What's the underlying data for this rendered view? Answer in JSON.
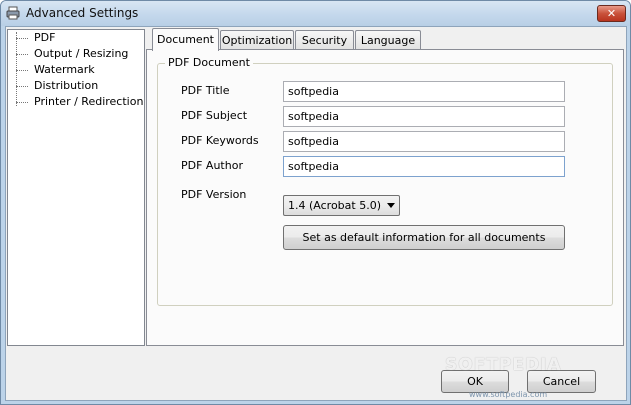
{
  "window": {
    "title": "Advanced Settings",
    "close_label": "✕"
  },
  "tree": {
    "items": [
      {
        "label": "PDF"
      },
      {
        "label": "Output / Resizing"
      },
      {
        "label": "Watermark"
      },
      {
        "label": "Distribution"
      },
      {
        "label": "Printer / Redirection"
      }
    ]
  },
  "tabs": [
    {
      "label": "Document",
      "active": true
    },
    {
      "label": "Optimization"
    },
    {
      "label": "Security"
    },
    {
      "label": "Language"
    }
  ],
  "document": {
    "group_title": "PDF Document",
    "fields": [
      {
        "label": "PDF Title",
        "value": "softpedia"
      },
      {
        "label": "PDF Subject",
        "value": "softpedia"
      },
      {
        "label": "PDF Keywords",
        "value": "softpedia"
      },
      {
        "label": "PDF Author",
        "value": "softpedia"
      }
    ],
    "version_label": "PDF Version",
    "version_value": "1.4  (Acrobat 5.0)",
    "default_button": "Set as default information for all documents"
  },
  "footer": {
    "ok_label": "OK",
    "cancel_label": "Cancel"
  },
  "watermark": {
    "brand": "SOFTPEDIA",
    "url": "www.softpedia.com"
  },
  "colors": {
    "frame": "#bcd3e9",
    "close_button": "#c9523b",
    "panel_background": "#fbfbfb"
  }
}
